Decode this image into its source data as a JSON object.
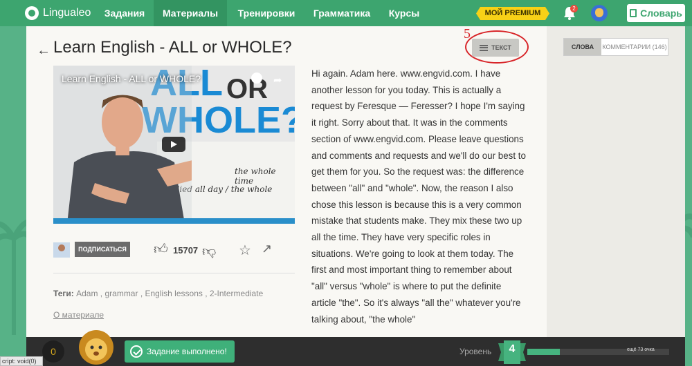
{
  "nav": {
    "logo": "Lingualeo",
    "items": [
      {
        "label": "Задания",
        "active": false
      },
      {
        "label": "Материалы",
        "active": true
      },
      {
        "label": "Тренировки",
        "active": false
      },
      {
        "label": "Грамматика",
        "active": false
      },
      {
        "label": "Курсы",
        "active": false
      }
    ],
    "premium": "МОЙ PREMIUM",
    "notifications": "2",
    "dictionary": "Словарь"
  },
  "material": {
    "title": "Learn English - ALL or WHOLE?",
    "text_button": "ТЕКСТ",
    "annotation_number": "5"
  },
  "side_tabs": {
    "words": "СЛОВА",
    "comments": "КОММЕНТАРИИ (146)"
  },
  "video": {
    "title": "Learn English - ALL or WHOLE?",
    "big_all": "ALL",
    "big_or": "OR",
    "big_whole": "WHOLE?",
    "board_line1": "the whole time",
    "board_line2": "studied all day / the whole"
  },
  "actions": {
    "subscribe": "ПОДПИСАТЬСЯ",
    "likes": "15707"
  },
  "tags": {
    "label": "Теги:",
    "list": "Adam , grammar , English lessons , 2-Intermediate"
  },
  "about_link": "О материале",
  "transcript": "Hi again. Adam here. www.engvid.com. I have another lesson for you today. This is actually a request by Feresque — Feresser? I hope I'm saying it right. Sorry about that. It was in the comments section of www.engvid.com. Please leave questions and comments and requests and we'll do our best to get them for you. So the request was: the difference between \"all\" and \"whole\". Now, the reason I also chose this lesson is because this is a very common mistake that students make. They mix these two up all the time. They have very specific roles in situations. We're going to look at them today. The first and most important thing to remember about \"all\" versus \"whole\" is where to put the definite article \"the\". So it's always \"all the\" whatever you're talking about, \"the whole\"",
  "bottom": {
    "coins": "0",
    "toast": "Задание выполнено!",
    "level_label": "Уровень",
    "level": "4",
    "progress_fraction": 0.23,
    "progress_label": "ещё 73 очка"
  },
  "status_bar": "cript: void(0)",
  "colors": {
    "nav_green": "#3da56f",
    "active_nav": "#339461",
    "premium_yellow": "#f7d117",
    "annotation_red": "#d8262a",
    "video_blue": "#1a8ad4"
  }
}
